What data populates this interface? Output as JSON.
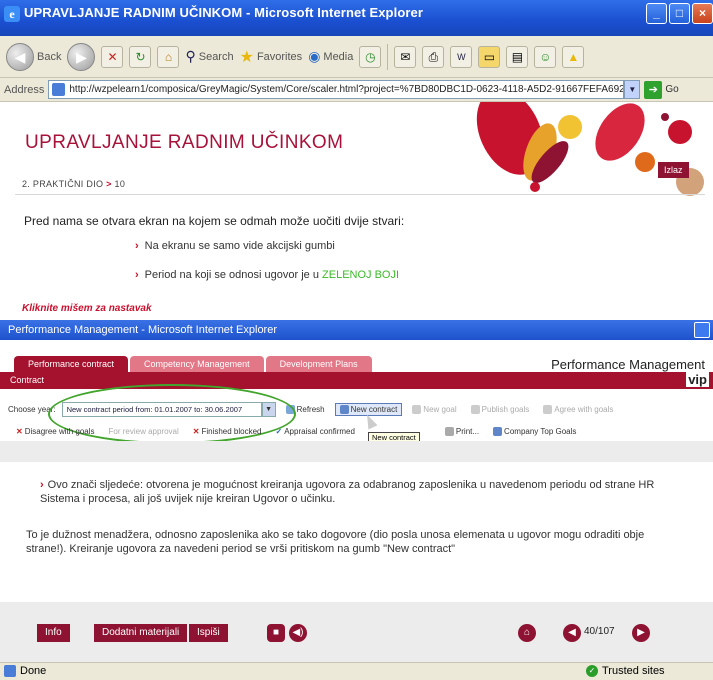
{
  "outer_window": {
    "title": "UPRAVLJANJE RADNIM UČINKOM - Microsoft Internet Explorer",
    "icon": "ie-icon"
  },
  "toolbar": {
    "back_label": "Back",
    "search_label": "Search",
    "favorites_label": "Favorites",
    "media_label": "Media"
  },
  "address": {
    "label": "Address",
    "url": "http://wzpelearn1/composica/GreyMagic/System/Core/scaler.html?project=%7BD80DBC1D-0623-4118-A5D2-91667FEFA692%7C",
    "go_label": "Go"
  },
  "course": {
    "title": "UPRAVLJANJE RADNIM UČINKOM",
    "breadcrumb_part": "2. PRAKTIČNI DIO",
    "breadcrumb_arrow": ">",
    "breadcrumb_page": "10",
    "exit_label": "Izlaz",
    "intro": "Pred nama se otvara ekran na kojem se odmah može uočiti dvije stvari:",
    "bullet1": "Na ekranu se samo vide akcijski gumbi",
    "bullet2_prefix": "Period na koji se odnosi ugovor je u",
    "bullet2_highlight": "ZELENOJ BOJI",
    "click_prompt": "Kliknite mišem za nastavak"
  },
  "inner_window": {
    "title": "Performance Management - Microsoft Internet Explorer"
  },
  "pm": {
    "tabs": [
      "Performance contract",
      "Competency Management",
      "Development Plans"
    ],
    "app_title": "Performance Management",
    "section": "Contract",
    "logo": "vip",
    "year_label": "Choose year:",
    "year_value": "New contract period from: 01.01.2007 to: 30.06.2007",
    "refresh_label": "Refresh",
    "new_contract_label": "New contract",
    "new_goal_label": "New goal",
    "publish_goals_label": "Publish goals",
    "agree_goals_label": "Agree with goals",
    "disagree_label": "Disagree with goals",
    "for_review_label": "For review approval",
    "finished_label": "Finished blocked",
    "appraisal_label": "Appraisal confirmed",
    "print_label": "Print...",
    "company_goals_label": "Company Top Goals",
    "tooltip": "New contract"
  },
  "explanation": {
    "para1": "Ovo znači sljedeće: otvorena je mogućnost kreiranja ugovora za odabranog zaposlenika u navedenom periodu od strane HR Sistema i procesa, ali još uvijek nije kreiran Ugovor o učinku.",
    "para2": "To je dužnost menadžera, odnosno zaposlenika ako se tako dogovore (dio posla unosa elemenata u ugovor mogu odraditi obje strane!). Kreiranje ugovora za navedeni period se vrši pritiskom na gumb \"New contract\""
  },
  "bottom": {
    "info_label": "Info",
    "materials_label": "Dodatni materijali",
    "print_label": "Ispiši",
    "page_indicator": "40/107"
  },
  "status": {
    "left": "Done",
    "right": "Trusted sites"
  },
  "colors": {
    "brand": "#a4122e",
    "highlight_green": "#3cb829",
    "xp_blue": "#1d52cc"
  }
}
